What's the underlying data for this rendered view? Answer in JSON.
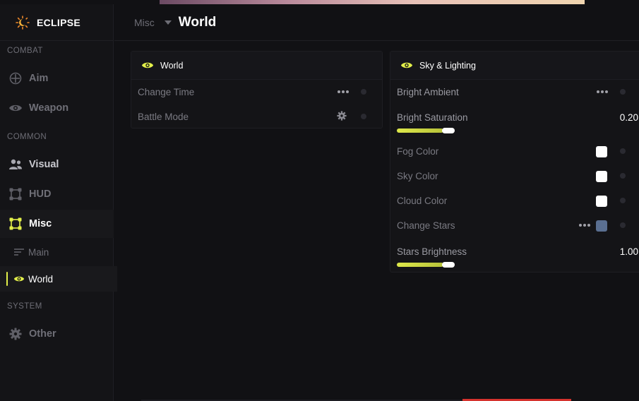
{
  "app": {
    "name": "ECLIPSE"
  },
  "sidebar": {
    "sections": [
      {
        "label": "COMBAT"
      },
      {
        "label": "COMMON"
      },
      {
        "label": "SYSTEM"
      }
    ],
    "items": [
      {
        "label": "Aim",
        "icon": "crosshair-icon"
      },
      {
        "label": "Weapon",
        "icon": "eye-icon"
      },
      {
        "label": "Visual",
        "icon": "users-icon"
      },
      {
        "label": "HUD",
        "icon": "nodes-icon"
      },
      {
        "label": "Misc",
        "icon": "nodes-icon",
        "active": true
      },
      {
        "label": "Other",
        "icon": "gear-icon"
      }
    ],
    "sub_items": [
      {
        "label": "Main",
        "icon": "lines-icon"
      },
      {
        "label": "World",
        "icon": "eye-icon",
        "active": true
      }
    ]
  },
  "header": {
    "breadcrumb": "Misc",
    "title": "World"
  },
  "panels": {
    "world": {
      "title": "World",
      "rows": [
        {
          "label": "Change Time"
        },
        {
          "label": "Battle Mode"
        }
      ]
    },
    "sky": {
      "title": "Sky & Lighting",
      "rows": [
        {
          "label": "Bright Ambient"
        },
        {
          "label": "Bright Saturation",
          "value": "0.20",
          "slider_fraction": 0.8
        },
        {
          "label": "Fog Color",
          "color": "#ffffff"
        },
        {
          "label": "Sky Color",
          "color": "#ffffff"
        },
        {
          "label": "Cloud Color",
          "color": "#ffffff"
        },
        {
          "label": "Change Stars",
          "color": "#5a6f91"
        },
        {
          "label": "Stars Brightness",
          "value": "1.00",
          "slider_fraction": 0.8
        }
      ]
    }
  },
  "colors": {
    "accent": "#e3f04a",
    "background": "#111114",
    "panel": "#141417"
  }
}
